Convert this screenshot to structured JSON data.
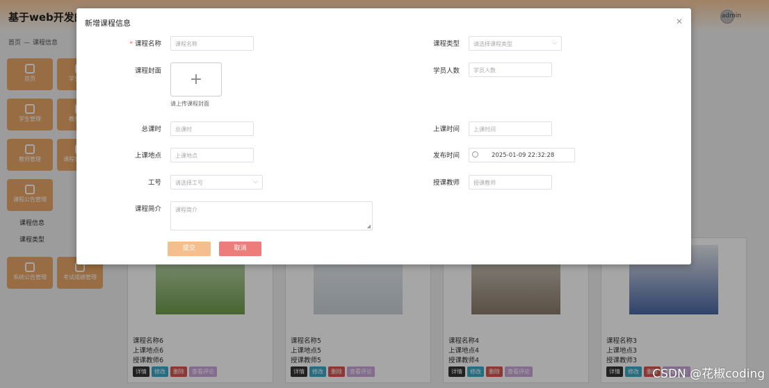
{
  "app": {
    "title": "基于web开发的",
    "user": "admin"
  },
  "breadcrumb": {
    "home": "首页",
    "current": "课程信息"
  },
  "sidebar": {
    "tiles": [
      "首页",
      "学生管理",
      "学生管理",
      "教师管理",
      "教师管理",
      "课程信息管理",
      "课程公告管理",
      "系统公告管理",
      "考试成绩管理"
    ],
    "subitems": [
      "课程信息",
      "课程类型"
    ]
  },
  "cards": [
    {
      "name": "课程名称6",
      "place": "上课地点6",
      "teacher": "授课教师6"
    },
    {
      "name": "课程名称5",
      "place": "上课地点5",
      "teacher": "授课教师5"
    },
    {
      "name": "课程名称4",
      "place": "上课地点4",
      "teacher": "授课教师4"
    },
    {
      "name": "课程名称3",
      "place": "上课地点3",
      "teacher": "授课教师3"
    }
  ],
  "card_buttons": {
    "detail": "详情",
    "edit": "修改",
    "delete": "删除",
    "comments": "查看评论"
  },
  "modal": {
    "title": "新增课程信息",
    "fields": {
      "course_name": {
        "label": "课程名称",
        "placeholder": "课程名称"
      },
      "course_type": {
        "label": "课程类型",
        "placeholder": "请选择课程类型"
      },
      "cover": {
        "label": "课程封面",
        "hint": "请上传课程封面"
      },
      "student_count": {
        "label": "学员人数",
        "placeholder": "学员人数"
      },
      "total_hours": {
        "label": "总课时",
        "placeholder": "总课时"
      },
      "class_time": {
        "label": "上课时间",
        "placeholder": "上课时间"
      },
      "class_place": {
        "label": "上课地点",
        "placeholder": "上课地点"
      },
      "publish_time": {
        "label": "发布时间",
        "value": "2025-01-09 22:32:28"
      },
      "job_no": {
        "label": "工号",
        "placeholder": "请选择工号"
      },
      "teacher": {
        "label": "授课教师",
        "placeholder": "授课教师"
      },
      "intro": {
        "label": "课程简介",
        "placeholder": "课程简介"
      }
    },
    "submit": "提交",
    "cancel": "取消"
  },
  "watermark": "CSDN @花椒coding",
  "colors": {
    "accent": "#eca867",
    "submit": "#f5be8d",
    "cancel": "#ec7d7a"
  }
}
